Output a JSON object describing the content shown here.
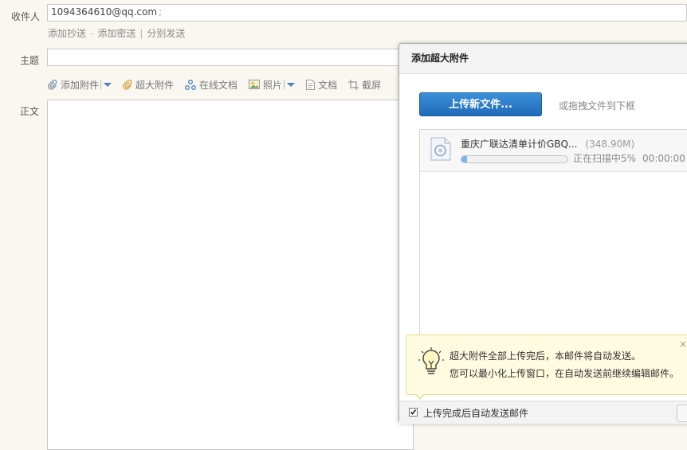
{
  "compose": {
    "to_label": "收件人",
    "to_value": "1094364610@qq.com",
    "to_separator": ";",
    "cc_link": "添加抄送",
    "dash": "-",
    "bcc_link": "添加密送",
    "pipe": "|",
    "separate_link": "分别发送",
    "subject_label": "主题",
    "body_label": "正文"
  },
  "toolbar": {
    "add_attachment": "添加附件",
    "big_attachment": "超大附件",
    "online_doc": "在线文档",
    "photo": "照片",
    "document": "文档",
    "screenshot": "截屏"
  },
  "dialog": {
    "title": "添加超大附件",
    "upload_button": "上传新文件...",
    "drag_hint": "或拖拽文件到下框",
    "file": {
      "name": "重庆广联达清单计价GBQ...",
      "size": "(348.90M)",
      "status": "正在扫描中5%",
      "time": "00:00:00",
      "progress_percent": 5
    },
    "tip": {
      "line1": "超大附件全部上传完后，本邮件将自动发送。",
      "line2": "您可以最小化上传窗口，在自动发送前继续编辑邮件。",
      "close": "×"
    },
    "auto_send_label": "上传完成后自动发送邮件"
  },
  "colors": {
    "accent": "#1f6bb8",
    "background": "#faf7f1",
    "tip_bg": "#fffbe0"
  }
}
